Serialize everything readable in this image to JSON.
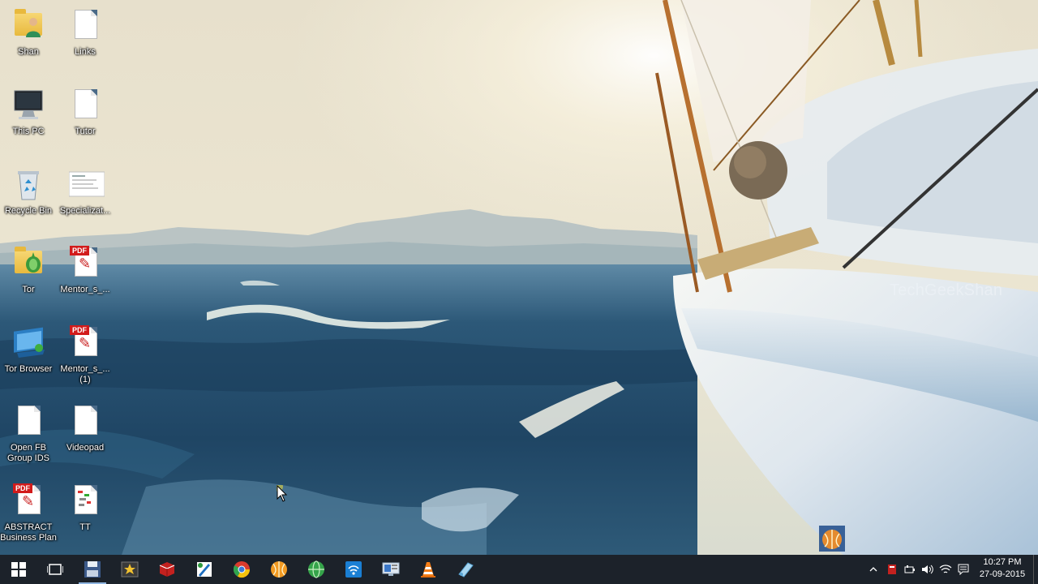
{
  "desktop": {
    "icons": [
      {
        "label": "Shan",
        "type": "user-folder-icon"
      },
      {
        "label": "Links",
        "type": "text-file-icon"
      },
      {
        "label": "This PC",
        "type": "computer-icon"
      },
      {
        "label": "Tutor",
        "type": "text-file-icon"
      },
      {
        "label": "Recycle Bin",
        "type": "recycle-bin-icon"
      },
      {
        "label": "Specializat...",
        "type": "image-file-icon"
      },
      {
        "label": "Tor",
        "type": "tor-folder-icon"
      },
      {
        "label": "Mentor_s_...",
        "type": "pdf-file-icon",
        "badge": "PDF"
      },
      {
        "label": "Tor Browser",
        "type": "tor-browser-icon"
      },
      {
        "label": "Mentor_s_...\n(1)",
        "type": "pdf-file-icon",
        "badge": "PDF"
      },
      {
        "label": "Open FB\nGroup IDS",
        "type": "text-file-icon"
      },
      {
        "label": "Videopad",
        "type": "text-file-icon"
      },
      {
        "label": "ABSTRACT\nBusiness Plan",
        "type": "pdf-file-icon",
        "badge": "PDF"
      },
      {
        "label": "TT",
        "type": "spreadsheet-file-icon"
      }
    ],
    "watermark": "TechGeekShan"
  },
  "taskbar": {
    "buttons": [
      {
        "name": "start-button",
        "icon": "windows-logo-icon"
      },
      {
        "name": "task-view-button",
        "icon": "task-view-icon"
      },
      {
        "name": "taskbar-app-save",
        "icon": "floppy-disk-icon"
      },
      {
        "name": "taskbar-app-movie-maker",
        "icon": "star-film-icon"
      },
      {
        "name": "taskbar-app-red-box",
        "icon": "red-box-icon"
      },
      {
        "name": "taskbar-app-paint",
        "icon": "paint-icon"
      },
      {
        "name": "taskbar-app-chrome",
        "icon": "chrome-icon"
      },
      {
        "name": "taskbar-app-orange-globe",
        "icon": "orange-globe-icon"
      },
      {
        "name": "taskbar-app-green-globe",
        "icon": "green-globe-icon"
      },
      {
        "name": "taskbar-app-wifi-hotspot",
        "icon": "wifi-hotspot-icon"
      },
      {
        "name": "taskbar-app-monitor",
        "icon": "monitor-icon"
      },
      {
        "name": "taskbar-app-vlc",
        "icon": "vlc-cone-icon"
      },
      {
        "name": "taskbar-app-snipping",
        "icon": "snipping-tool-icon"
      }
    ],
    "active_button": "taskbar-app-save",
    "tray": [
      "chevron-up-icon",
      "red-app-tray-icon",
      "battery-icon",
      "volume-icon",
      "wifi-icon",
      "action-center-icon",
      "keyboard-icon"
    ],
    "clock": {
      "time": "10:27 PM",
      "date": "27-09-2015"
    }
  },
  "colors": {
    "taskbar": "#1c2028",
    "accent": "#8fb5e0"
  }
}
